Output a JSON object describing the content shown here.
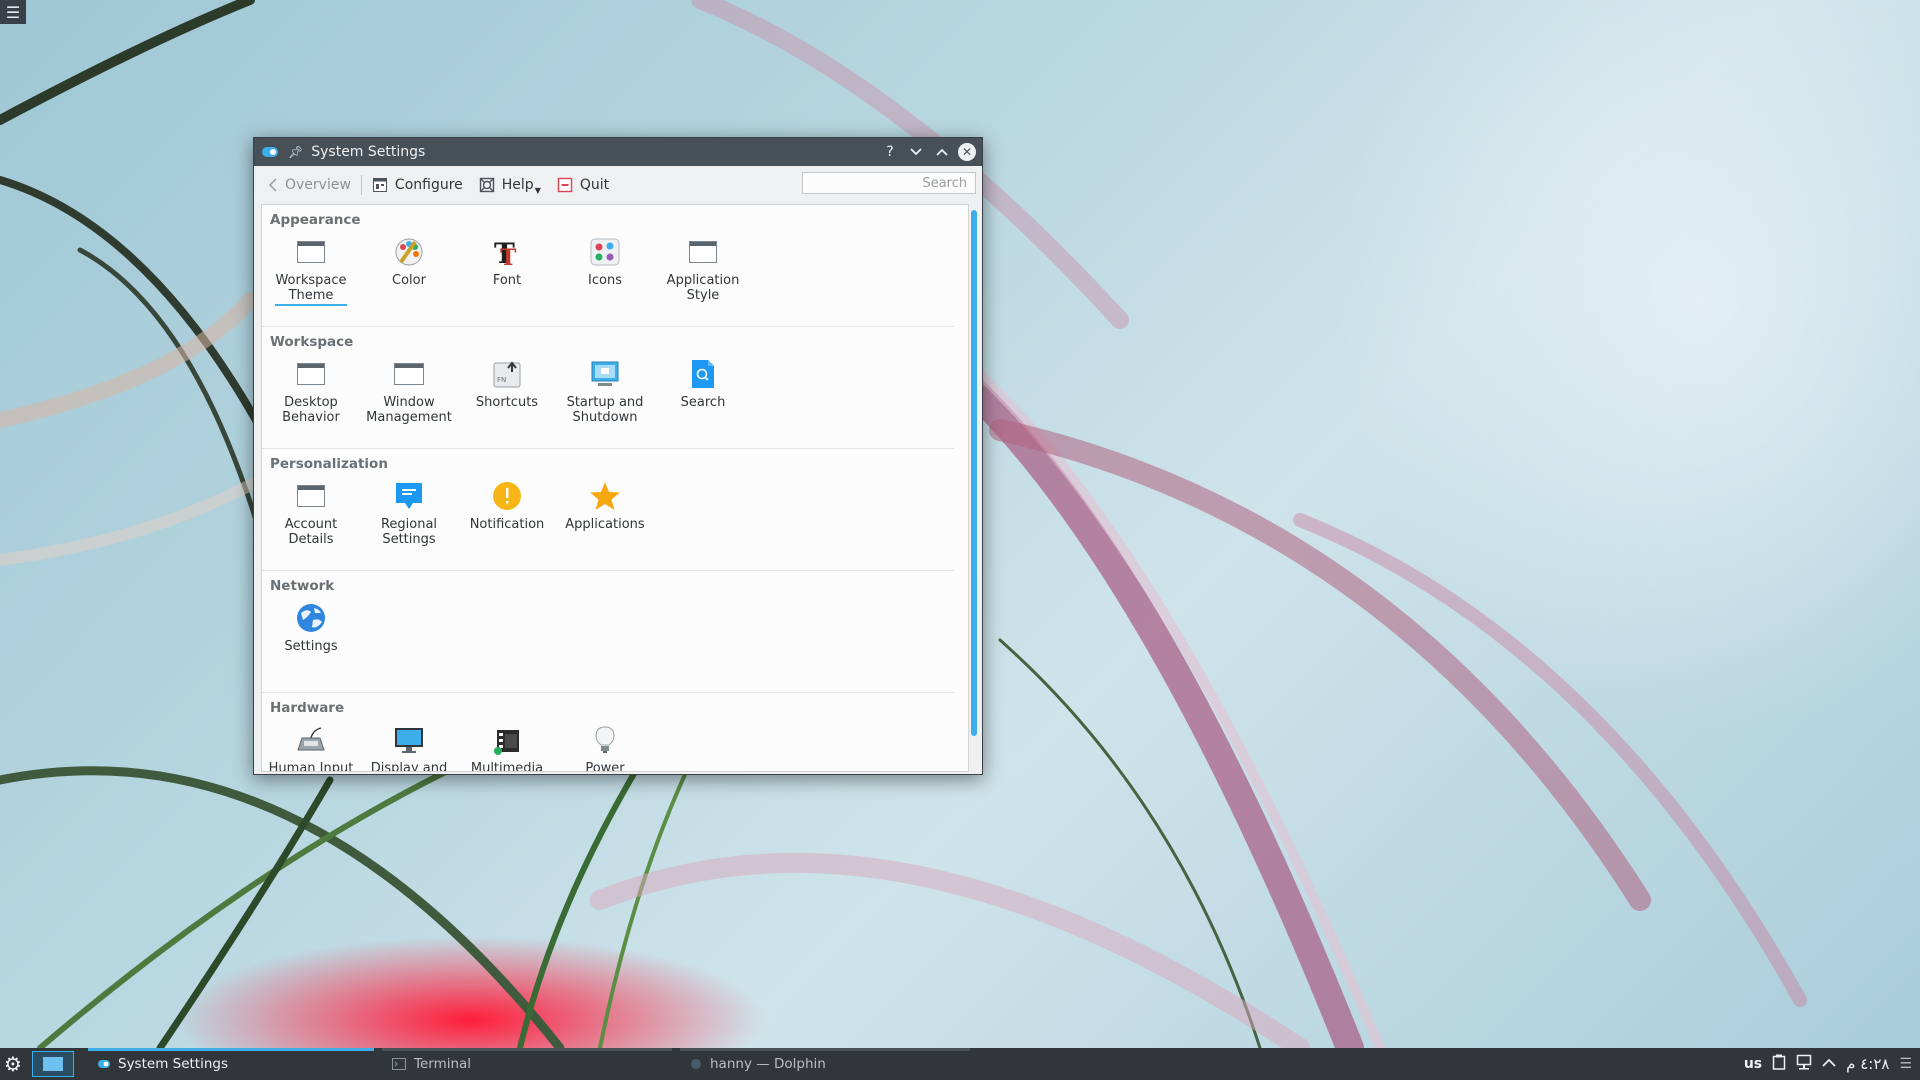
{
  "desktop": {
    "corner_menu_icon": "hamburger-menu-icon"
  },
  "window": {
    "title": "System Settings",
    "controls": {
      "help": "?",
      "minimize": "⌄",
      "maximize": "⌃",
      "close": "✕"
    }
  },
  "toolbar": {
    "overview": "Overview",
    "configure": "Configure",
    "help": "Help",
    "quit": "Quit",
    "search_placeholder": "Search"
  },
  "sections": {
    "appearance": {
      "title": "Appearance",
      "items": [
        {
          "label": "Workspace\nTheme",
          "icon": "workspace-theme-icon"
        },
        {
          "label": "Color",
          "icon": "color-palette-icon"
        },
        {
          "label": "Font",
          "icon": "font-icon"
        },
        {
          "label": "Icons",
          "icon": "icons-icon"
        },
        {
          "label": "Application\nStyle",
          "icon": "application-style-icon"
        }
      ]
    },
    "workspace": {
      "title": "Workspace",
      "items": [
        {
          "label": "Desktop\nBehavior",
          "icon": "desktop-behavior-icon"
        },
        {
          "label": "Window\nManagement",
          "icon": "window-management-icon"
        },
        {
          "label": "Shortcuts",
          "icon": "shortcuts-icon"
        },
        {
          "label": "Startup and\nShutdown",
          "icon": "startup-shutdown-icon"
        },
        {
          "label": "Search",
          "icon": "search-icon"
        }
      ]
    },
    "personalization": {
      "title": "Personalization",
      "items": [
        {
          "label": "Account\nDetails",
          "icon": "account-details-icon"
        },
        {
          "label": "Regional\nSettings",
          "icon": "regional-settings-icon"
        },
        {
          "label": "Notification",
          "icon": "notification-icon"
        },
        {
          "label": "Applications",
          "icon": "star-icon"
        }
      ]
    },
    "network": {
      "title": "Network",
      "items": [
        {
          "label": "Settings",
          "icon": "globe-icon"
        }
      ]
    },
    "hardware": {
      "title": "Hardware",
      "items": [
        {
          "label": "Human Input",
          "icon": "input-devices-icon"
        },
        {
          "label": "Display and",
          "icon": "monitor-icon"
        },
        {
          "label": "Multimedia",
          "icon": "multimedia-icon"
        },
        {
          "label": "Power",
          "icon": "lightbulb-icon"
        }
      ]
    }
  },
  "taskbar": {
    "tasks": [
      {
        "label": "System Settings"
      },
      {
        "label": "Terminal"
      },
      {
        "label": "hanny — Dolphin"
      }
    ],
    "tray": {
      "keyboard_layout": "us"
    },
    "clock": "٤:٢٨ م"
  },
  "colors": {
    "accent": "#3daee9",
    "titlebar": "#475057",
    "taskbar": "#31363b"
  }
}
